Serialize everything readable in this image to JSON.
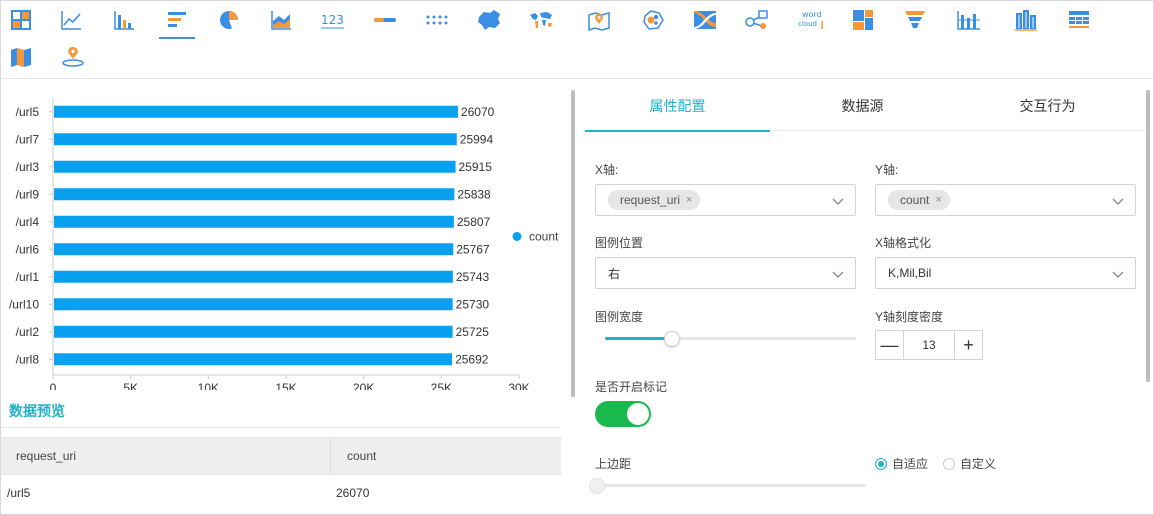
{
  "toolbar": {
    "icons": [
      "table-icon",
      "line-chart-icon",
      "bar-chart-icon",
      "horizontal-bar-icon",
      "pie-chart-icon",
      "area-chart-icon",
      "number-icon",
      "progress-icon",
      "dots-icon",
      "china-map-icon",
      "world-map-icon",
      "location-map-icon",
      "bubble-map-icon",
      "flow-map-icon",
      "relation-icon",
      "word-cloud-icon",
      "treemap-icon",
      "funnel-icon",
      "bar-grid-icon",
      "building-icon",
      "pivot-table-icon",
      "region-map-icon",
      "pin-map-icon"
    ],
    "number_label": "123",
    "word_cloud_line1": "word",
    "word_cloud_line2": "cloud",
    "active_index": 3
  },
  "chart_data": {
    "type": "bar",
    "orientation": "horizontal",
    "categories": [
      "/url5",
      "/url7",
      "/url3",
      "/url9",
      "/url4",
      "/url6",
      "/url1",
      "/url10",
      "/url2",
      "/url8"
    ],
    "series": [
      {
        "name": "count",
        "values": [
          26070,
          25994,
          25915,
          25838,
          25807,
          25767,
          25743,
          25730,
          25725,
          25692
        ]
      }
    ],
    "xlim": [
      0,
      30000
    ],
    "xticks": [
      "0",
      "5K",
      "10K",
      "15K",
      "20K",
      "25K",
      "30K"
    ],
    "data_labels": true,
    "legend": "right",
    "bar_color": "#0aa0f0"
  },
  "preview": {
    "title": "数据预览",
    "columns": [
      "request_uri",
      "count"
    ],
    "rows": [
      [
        "/url5",
        "26070"
      ]
    ]
  },
  "tabs": [
    {
      "label": "属性配置",
      "active": true
    },
    {
      "label": "数据源",
      "active": false
    },
    {
      "label": "交互行为",
      "active": false
    }
  ],
  "form": {
    "x_axis_label": "X轴:",
    "x_axis_tag": "request_uri",
    "y_axis_label": "Y轴:",
    "y_axis_tag": "count",
    "tag_close": "×",
    "legend_pos_label": "图例位置",
    "legend_pos_value": "右",
    "x_format_label": "X轴格式化",
    "x_format_value": "K,Mil,Bil",
    "legend_width_label": "图例宽度",
    "legend_width_level": 0.25,
    "y_tick_label": "Y轴刻度密度",
    "y_tick_value": "13",
    "minus": "—",
    "plus": "+",
    "marker_label": "是否开启标记",
    "marker_on": true,
    "top_margin_label": "上边距",
    "top_margin_level": 0,
    "radio_auto": "自适应",
    "radio_custom": "自定义",
    "radio_selected": "auto"
  },
  "colors": {
    "accent": "#1fb3c8",
    "bar": "#0aa0f0",
    "switch_on": "#19b94e",
    "orange": "#f5973b",
    "blue": "#3a8ee6"
  }
}
